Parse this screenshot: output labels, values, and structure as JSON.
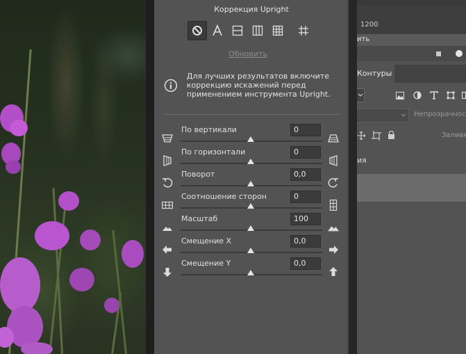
{
  "panel": {
    "title": "Коррекция Upright",
    "upright_buttons": [
      {
        "name": "upright-off-button",
        "icon": "no-symbol-icon",
        "active": true
      },
      {
        "name": "upright-auto-button",
        "icon": "letter-a-icon",
        "active": false
      },
      {
        "name": "upright-level-button",
        "icon": "level-icon",
        "active": false
      },
      {
        "name": "upright-vertical-button",
        "icon": "vertical-icon",
        "active": false
      },
      {
        "name": "upright-full-button",
        "icon": "grid-icon",
        "active": false
      },
      {
        "name": "upright-guided-button",
        "icon": "crop-guides-icon",
        "active": false
      }
    ],
    "update_link": "Обновить",
    "info_text": "Для лучших результатов включите коррекцию искажений перед применением инструмента Upright.",
    "sliders": [
      {
        "label": "По вертикали",
        "value": "0",
        "level": 0,
        "icon_left": "vertical-perspective-minus-icon",
        "icon_right": "vertical-perspective-plus-icon"
      },
      {
        "label": "По горизонтали",
        "value": "0",
        "level": 0,
        "icon_left": "horizontal-perspective-minus-icon",
        "icon_right": "horizontal-perspective-plus-icon"
      },
      {
        "label": "Поворот",
        "value": "0,0",
        "level": 0,
        "icon_left": "rotate-left-icon",
        "icon_right": "rotate-right-icon"
      },
      {
        "label": "Соотношение сторон",
        "value": "0",
        "level": 0,
        "icon_left": "aspect-wide-icon",
        "icon_right": "aspect-tall-icon"
      },
      {
        "label": "Масштаб",
        "value": "100",
        "level": 0,
        "icon_left": "scale-small-icon",
        "icon_right": "scale-large-icon"
      },
      {
        "label": "Смещение X",
        "value": "0,0",
        "level": 0,
        "icon_left": "arrow-left-icon",
        "icon_right": "arrow-right-icon"
      },
      {
        "label": "Смещение Y",
        "value": "0,0",
        "level": 0,
        "icon_left": "arrow-down-icon",
        "icon_right": "arrow-up-icon"
      }
    ]
  },
  "right_panel": {
    "width_value": "1200",
    "bar_text": "ить",
    "tab_paths": "Контуры",
    "opacity_label": "Непрозрачность",
    "fill_label": "Заливка",
    "layer_name_fragment": "ия"
  },
  "colors": {
    "panel_bg": "#535353",
    "dark_bg": "#2b2b2b",
    "field_bg": "#3b3b3b",
    "text": "#e0e0e0"
  }
}
